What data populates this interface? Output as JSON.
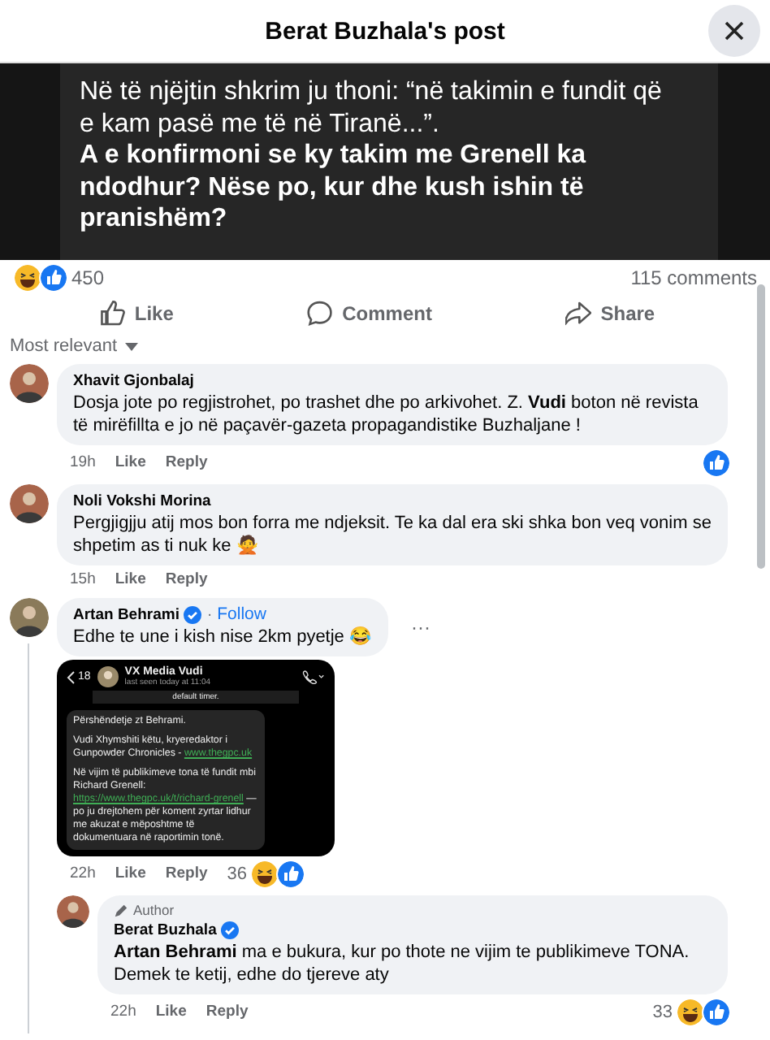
{
  "header": {
    "title": "Berat Buzhala's post"
  },
  "post_image": {
    "paragraphs": [
      {
        "text": "Në të njëjtin shkrim ju thoni: “në takimin e fundit që e kam pasë me të në Tiranë...”.",
        "bold": false
      },
      {
        "text": "A e konfirmoni se ky takim me Grenell ka ndodhur? Nëse po, kur dhe kush ishin të pranishëm?",
        "bold": true
      }
    ]
  },
  "summary": {
    "haha_reaction": true,
    "like_reaction": true,
    "count": "450",
    "comments": "115 comments"
  },
  "actions": [
    {
      "kind": "like",
      "label": "Like"
    },
    {
      "kind": "comment",
      "label": "Comment"
    },
    {
      "kind": "share",
      "label": "Share"
    }
  ],
  "sort": {
    "label": "Most relevant"
  },
  "comments": [
    {
      "author": "Xhavit Gjonbalaj",
      "verified": false,
      "text": "Dosja jote po regjistrohet, po trashet dhe po arkivohet. Z. **Vudi** boton në revista të mirëfillta e jo në paçavër-gazeta propagandistike Buzhaljane !",
      "time": "19h",
      "links": [
        "Like",
        "Reply"
      ],
      "like_reaction": true
    },
    {
      "author": "Noli Vokshi Morina",
      "verified": false,
      "text": "Pergjigjju atij mos bon forra me ndjeksit. Te ka dal era ski shka bon veq vonim se shpetim as ti nuk ke 🙅",
      "time": "15h",
      "links": [
        "Like",
        "Reply"
      ]
    },
    {
      "author": "Artan Behrami",
      "verified": true,
      "separator": "·",
      "follow": "Follow",
      "more": "···",
      "text": "Edhe te une i kish nise 2km pyetje 😂",
      "time": "22h",
      "links": [
        "Like",
        "Reply"
      ],
      "reaction_count": "36",
      "haha_reaction": true,
      "like_reaction": true,
      "attachment": {
        "back": "18",
        "contact": "Vudi",
        "contact_prefix": "VX Media",
        "status": "last seen today at 11:04",
        "notice": "default timer.",
        "message": [
          [
            {
              "text": "Përshëndetje zt Behrami."
            }
          ],
          [
            {
              "text": "Vudi Xhymshiti këtu, kryeredaktor i Gunpowder Chronicles - "
            },
            {
              "link": "www.thegpc.uk"
            }
          ],
          [
            {
              "text": "Në vijim të publikimeve tona të fundit mbi Richard Grenell: "
            },
            {
              "link": "https://"
            },
            {
              "link": "www.thegpc.uk/t/richard-grenell"
            },
            {
              "text": " — po ju drejtohem për koment zyrtar lidhur me akuzat e mëposhtme të dokumentuara në raportimin tonë."
            }
          ]
        ]
      },
      "replies": [
        {
          "badge": "Author",
          "author": "Berat Buzhala",
          "verified": true,
          "text": "**Artan Behrami** ma e bukura, kur po thote ne vijim te publikimeve TONA. Demek te ketij, edhe do tjereve aty",
          "time": "22h",
          "links": [
            "Like",
            "Reply"
          ],
          "reaction_count": "33",
          "haha_reaction": true,
          "like_reaction": true
        }
      ]
    }
  ]
}
